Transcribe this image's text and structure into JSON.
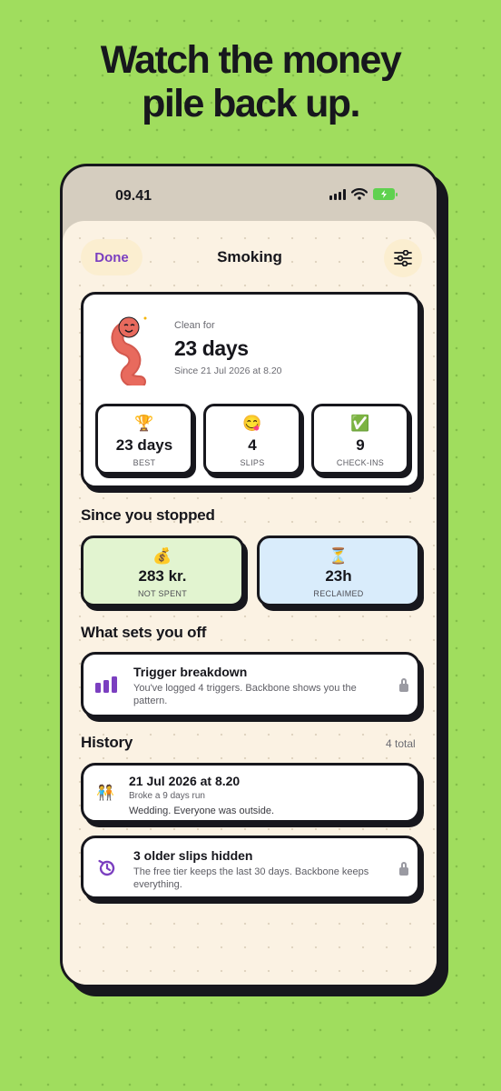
{
  "headline": {
    "line1": "Watch the money",
    "line2": "pile back up."
  },
  "status_bar": {
    "time": "09.41",
    "icons": [
      "signal-icon",
      "wifi-icon",
      "battery-charging-icon"
    ]
  },
  "nav": {
    "done_label": "Done",
    "title": "Smoking",
    "settings_icon": "sliders-icon"
  },
  "clean_card": {
    "mascot": "worm-mascot",
    "label": "Clean for",
    "value": "23 days",
    "since": "Since 21 Jul 2026 at 8.20",
    "stats": [
      {
        "emoji": "🏆",
        "value": "23 days",
        "label": "BEST"
      },
      {
        "emoji": "😋",
        "value": "4",
        "label": "SLIPS"
      },
      {
        "emoji": "✅",
        "value": "9",
        "label": "CHECK-INS"
      }
    ]
  },
  "since_stopped": {
    "title": "Since you stopped",
    "cards": [
      {
        "emoji": "💰",
        "value": "283 kr.",
        "label": "NOT SPENT",
        "color": "#e2f4d0"
      },
      {
        "emoji": "⏳",
        "value": "23h",
        "label": "RECLAIMED",
        "color": "#d9ecfb"
      }
    ]
  },
  "triggers": {
    "title": "What sets you off",
    "row_title": "Trigger breakdown",
    "row_sub": "You've logged 4 triggers. Backbone shows you the pattern.",
    "icon": "bar-chart-icon",
    "locked": true
  },
  "history": {
    "title": "History",
    "count": "4 total",
    "items": [
      {
        "icon": "🧑‍🤝‍🧑",
        "title": "21 Jul 2026 at 8.20",
        "sub": "Broke a 9 days run",
        "note": "Wedding. Everyone was outside."
      }
    ],
    "hidden": {
      "icon": "history-icon",
      "title": "3 older slips hidden",
      "sub": "The free tier keeps the last 30 days. Backbone keeps everything.",
      "locked": true
    }
  },
  "colors": {
    "background": "#a0dd5e",
    "accent": "#7b3fc0",
    "screen": "#fbf2e3",
    "ink": "#17171d"
  }
}
